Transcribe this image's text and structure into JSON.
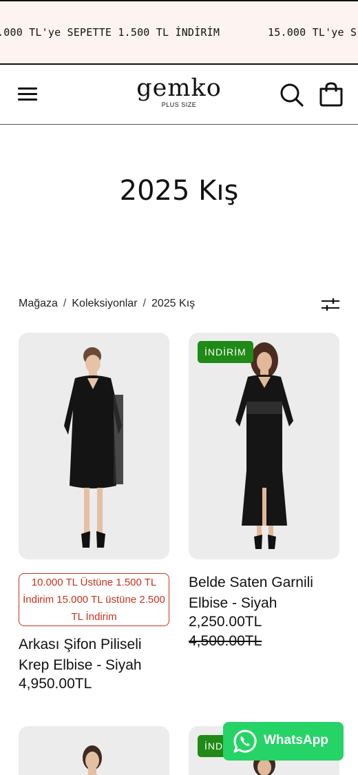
{
  "announcement": {
    "message_1": ".000 TL'ye SEPETTE 1.500 TL İNDİRİM",
    "message_2": "15.000 TL'ye S"
  },
  "header": {
    "logo_text": "gemko",
    "logo_subtitle": "PLUS SIZE",
    "icons": [
      "menu-icon",
      "search-icon",
      "shopping-bag-icon"
    ]
  },
  "page": {
    "title": "2025 Kış"
  },
  "breadcrumb": {
    "items": [
      "Mağaza",
      "Koleksiyonlar",
      "2025 Kış"
    ],
    "separator": "/"
  },
  "products": [
    {
      "promo_text": "10.000 TL Üstüne 1.500 TL İndirim 15.000 TL üstüne 2.500 TL İndirim",
      "name": "Arkası Şifon Piliseli Krep Elbise - Siyah",
      "price": "4,950.00TL"
    },
    {
      "badge": "İNDİRİM",
      "name": "Belde Saten Garnili Elbise - Siyah",
      "price": "2,250.00TL",
      "old_price": "4,500.00TL"
    },
    {},
    {
      "badge": "İNDİRİM"
    }
  ],
  "whatsapp": {
    "label": "WhatsApp",
    "color": "#25d366"
  },
  "colors": {
    "announcement_bg": "#fdf4f1",
    "badge_bg": "#1f8a16",
    "promo_border": "#c8321d"
  }
}
